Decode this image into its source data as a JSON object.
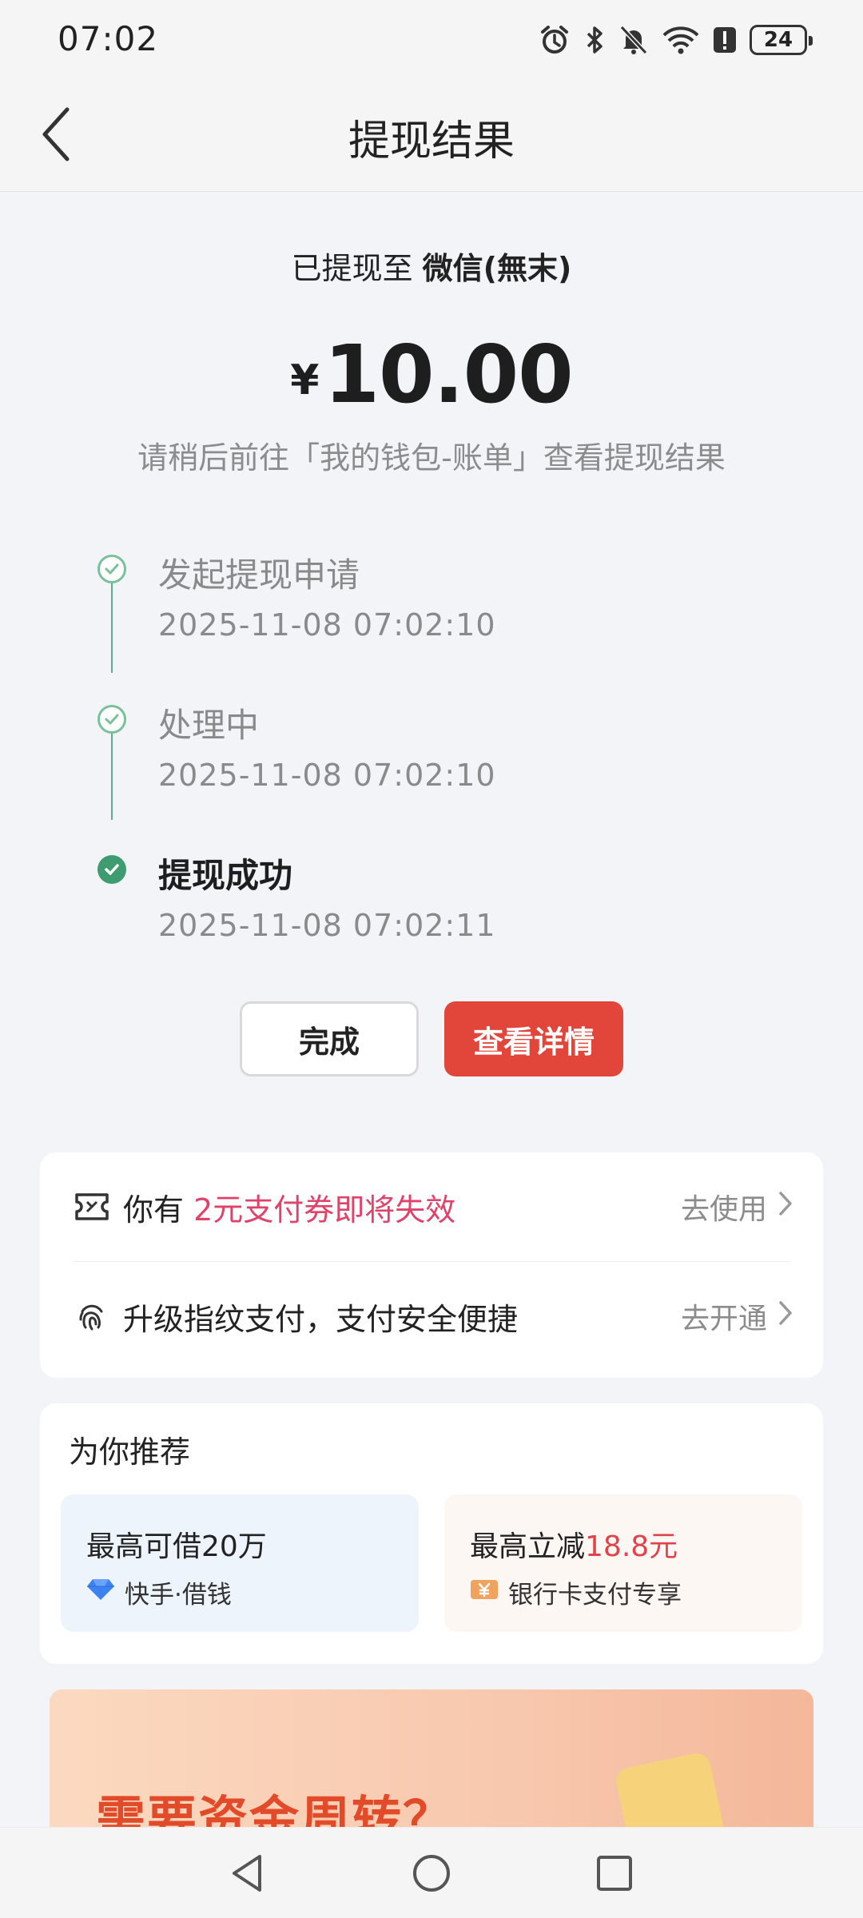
{
  "status_bar": {
    "time": "07:02",
    "battery": "24",
    "icons": [
      "alarm-icon",
      "bluetooth-icon",
      "bell-muted-icon",
      "wifi-icon",
      "alert-icon",
      "battery-icon"
    ]
  },
  "header": {
    "title": "提现结果",
    "back_icon": "chevron-left-icon"
  },
  "result": {
    "to_prefix": "已提现至",
    "to_account": "微信(無末)",
    "currency_symbol": "¥",
    "amount": "10.00",
    "hint": "请稍后前往「我的钱包-账单」查看提现结果"
  },
  "timeline": [
    {
      "title": "发起提现申请",
      "time": "2025-11-08 07:02:10",
      "state": "done"
    },
    {
      "title": "处理中",
      "time": "2025-11-08 07:02:10",
      "state": "done"
    },
    {
      "title": "提现成功",
      "time": "2025-11-08 07:02:11",
      "state": "success"
    }
  ],
  "buttons": {
    "done": "完成",
    "detail": "查看详情"
  },
  "promo": {
    "coupon": {
      "prefix": "你有 ",
      "highlight": "2元支付券即将失效",
      "action": "去使用"
    },
    "fingerprint": {
      "text": "升级指纹支付，支付安全便捷",
      "action": "去开通"
    }
  },
  "recommend": {
    "title": "为你推荐",
    "tiles": [
      {
        "main": "最高可借20万",
        "main_highlight": "",
        "sub": "快手·借钱",
        "icon": "diamond-icon"
      },
      {
        "main": "最高立减",
        "main_highlight": "18.8元",
        "sub": "银行卡支付专享",
        "icon": "yen-card-icon"
      }
    ]
  },
  "banner": {
    "title": "需要资金周转？"
  },
  "colors": {
    "accent_red": "#e2463b",
    "highlight_pink": "#e0436a",
    "success_green": "#3f9b70"
  }
}
